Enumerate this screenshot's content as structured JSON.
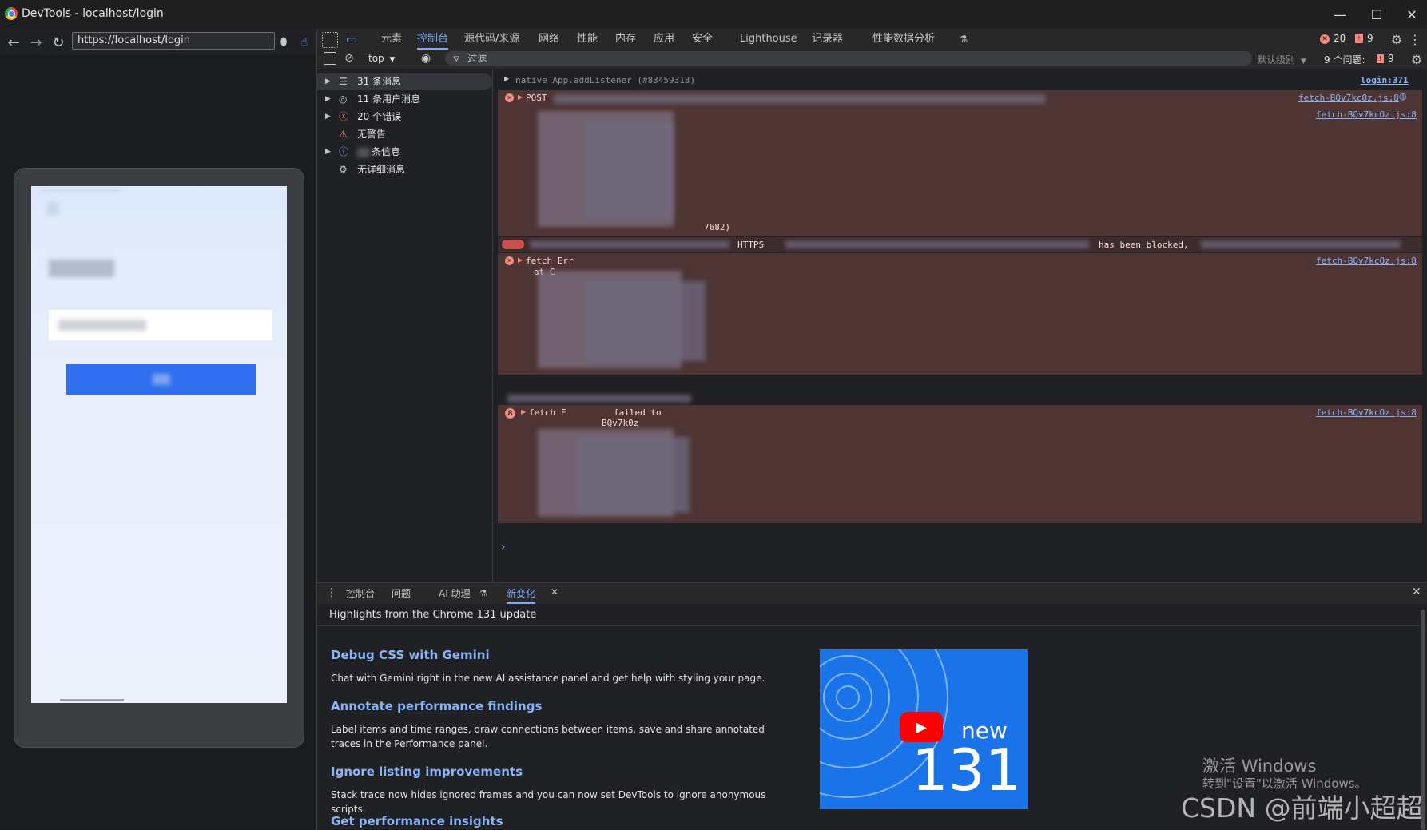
{
  "window": {
    "title": "DevTools - localhost/login",
    "controls": {
      "minimize": "—",
      "maximize": "☐",
      "close": "✕"
    }
  },
  "browser": {
    "url": "https://localhost/login"
  },
  "devtools_tabs": [
    {
      "label": "元素",
      "active": false
    },
    {
      "label": "控制台",
      "active": true
    },
    {
      "label": "源代码/来源",
      "active": false
    },
    {
      "label": "网络",
      "active": false
    },
    {
      "label": "性能",
      "active": false
    },
    {
      "label": "内存",
      "active": false
    },
    {
      "label": "应用",
      "active": false
    },
    {
      "label": "安全",
      "active": false
    },
    {
      "label": "Lighthouse",
      "active": false
    },
    {
      "label": "记录器",
      "active": false
    },
    {
      "label": "性能数据分析",
      "active": false
    }
  ],
  "toolbar_counts": {
    "errors": "20",
    "issues": "9"
  },
  "console_toolbar": {
    "context": "top",
    "filter_placeholder": "过滤",
    "level": "默认级别",
    "issues_label": "9 个问题:",
    "issues_count": "9"
  },
  "sidebar": {
    "items": [
      {
        "label": "31 条消息",
        "icon": "list-icon",
        "expandable": true,
        "selected": true
      },
      {
        "label": "11 条用户消息",
        "icon": "user-icon",
        "expandable": true,
        "selected": false
      },
      {
        "label": "20 个错误",
        "icon": "error-icon",
        "expandable": true,
        "selected": false
      },
      {
        "label": "无警告",
        "icon": "warning-icon",
        "expandable": false,
        "selected": false
      },
      {
        "label": "条信息",
        "icon": "info-icon",
        "expandable": true,
        "selected": false
      },
      {
        "label": "无详细消息",
        "icon": "verbose-icon",
        "expandable": false,
        "selected": false
      }
    ]
  },
  "console": {
    "native_line": "native App.addListener (#83459313)",
    "native_source": "login:371",
    "msg_post": "POST",
    "msg_fetch1": "fetch Err",
    "msg_fetch1_b": "at C",
    "msg_blocked": "has been blocked,",
    "msg_https": "HTTPS",
    "msg_fetch2": "fetch F",
    "msg_fetch2_b": "failed to",
    "msg_fetch_code": "BQv7k0z",
    "msg_zero": "7682)",
    "sources": [
      "fetch-BQv7kcOz.js:8",
      "fetch-BQv7kcOz.js:8",
      "fetch-BQv7kcOz.js:8",
      "fetch-BQv7kcOz.js:8"
    ],
    "prompt": "›"
  },
  "drawer": {
    "tabs": [
      {
        "label": "控制台",
        "active": false,
        "closable": false
      },
      {
        "label": "问题",
        "active": false,
        "closable": false
      },
      {
        "label": "AI 助理",
        "active": false,
        "closable": false
      },
      {
        "label": "新变化",
        "active": true,
        "closable": true
      }
    ],
    "heading": "Highlights from the Chrome 131 update",
    "features": [
      {
        "title": "Debug CSS with Gemini",
        "desc": "Chat with Gemini right in the new AI assistance panel and get help with styling your page."
      },
      {
        "title": "Annotate performance findings",
        "desc": "Label items and time ranges, draw connections between items, save and share annotated traces in the Performance panel."
      },
      {
        "title": "Ignore listing improvements",
        "desc": "Stack trace now hides ignored frames and you can now set DevTools to ignore anonymous scripts."
      },
      {
        "title": "Get performance insights",
        "desc": ""
      }
    ],
    "video": {
      "word": "new",
      "number": "131"
    }
  },
  "watermarks": {
    "activate_title": "激活 Windows",
    "activate_sub": "转到\"设置\"以激活 Windows。",
    "csdn": "CSDN @前端小超超"
  },
  "colors": {
    "accent": "#7cacf8",
    "error": "#f28b82",
    "error_bg": "#4e3534",
    "link": "#8ab4f8",
    "primary_button": "#2f6ff0"
  }
}
